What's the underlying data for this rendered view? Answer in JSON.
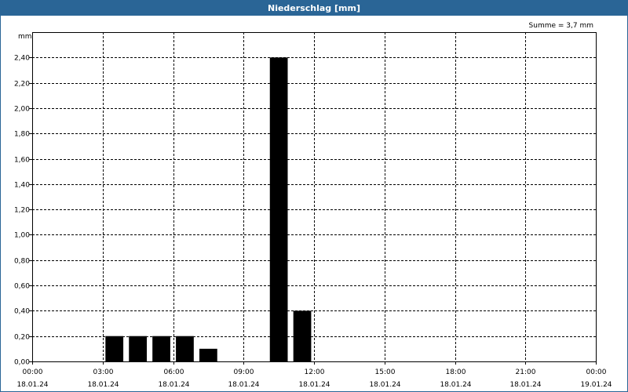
{
  "window": {
    "title": "Niederschlag [mm]"
  },
  "chart_data": {
    "type": "bar",
    "title": "Niederschlag [mm]",
    "ylabel": "mm",
    "annotation": "Summe = 3,7 mm",
    "ylim": [
      0,
      2.6
    ],
    "y_ticks": [
      "0,00",
      "0,20",
      "0,40",
      "0,60",
      "0,80",
      "1,00",
      "1,20",
      "1,40",
      "1,60",
      "1,80",
      "2,00",
      "2,20",
      "2,40"
    ],
    "y_tick_values": [
      0,
      0.2,
      0.4,
      0.6,
      0.8,
      1.0,
      1.2,
      1.4,
      1.6,
      1.8,
      2.0,
      2.2,
      2.4
    ],
    "x_range_hours": [
      0,
      24
    ],
    "x_ticks": [
      {
        "time": "00:00",
        "date": "18.01.24"
      },
      {
        "time": "03:00",
        "date": "18.01.24"
      },
      {
        "time": "06:00",
        "date": "18.01.24"
      },
      {
        "time": "09:00",
        "date": "18.01.24"
      },
      {
        "time": "12:00",
        "date": "18.01.24"
      },
      {
        "time": "15:00",
        "date": "18.01.24"
      },
      {
        "time": "18:00",
        "date": "18.01.24"
      },
      {
        "time": "21:00",
        "date": "18.01.24"
      },
      {
        "time": "00:00",
        "date": "19.01.24"
      }
    ],
    "bars": [
      {
        "start": "03:00",
        "end": "04:00",
        "value": 0.2
      },
      {
        "start": "04:00",
        "end": "05:00",
        "value": 0.2
      },
      {
        "start": "05:00",
        "end": "06:00",
        "value": 0.2
      },
      {
        "start": "06:00",
        "end": "07:00",
        "value": 0.2
      },
      {
        "start": "07:00",
        "end": "08:00",
        "value": 0.1
      },
      {
        "start": "10:00",
        "end": "11:00",
        "value": 2.4
      },
      {
        "start": "11:00",
        "end": "12:00",
        "value": 0.4
      }
    ],
    "grid": true,
    "bar_color": "#000000",
    "grid_color": "#000000"
  }
}
